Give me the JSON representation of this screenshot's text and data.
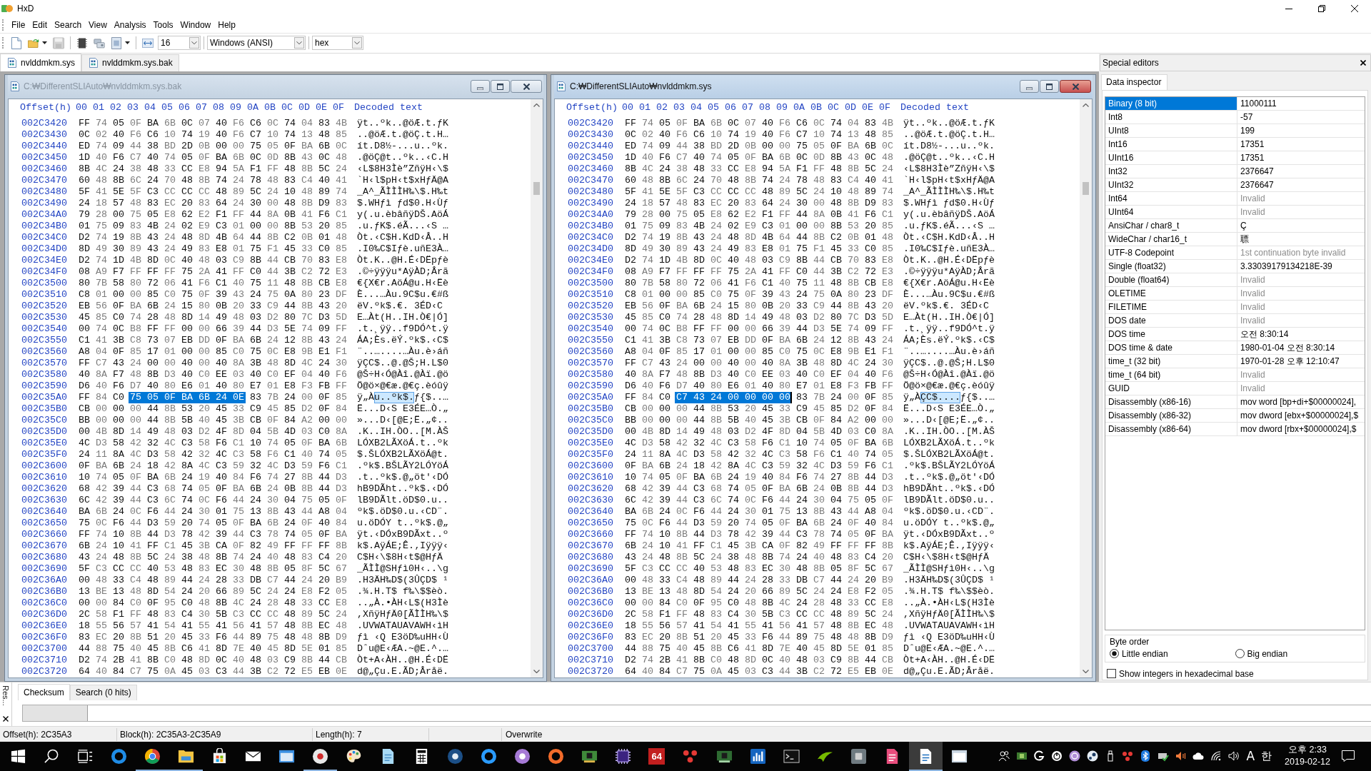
{
  "window": {
    "title": "HxD"
  },
  "menu": [
    "File",
    "Edit",
    "Search",
    "View",
    "Analysis",
    "Tools",
    "Window",
    "Help"
  ],
  "toolbar": {
    "bytes_per_row": "16",
    "encoding": "Windows (ANSI)",
    "offset_base": "hex"
  },
  "file_tabs": [
    {
      "label": "nvlddmkm.sys",
      "selected": true
    },
    {
      "label": "nvlddmkm.sys.bak",
      "selected": false
    }
  ],
  "editors": [
    {
      "title": "C:₩DifferentSLIAuto₩nvlddmkm.sys.bak",
      "active": false,
      "header": {
        "offset": "Offset(h)",
        "columns": [
          "00",
          "01",
          "02",
          "03",
          "04",
          "05",
          "06",
          "07",
          "08",
          "09",
          "0A",
          "0B",
          "0C",
          "0D",
          "0E",
          "0F"
        ],
        "decoded": "Decoded text"
      },
      "rows": [
        {
          "offset": "002C3420",
          "kind": "plain",
          "hex": "FF 74 05 0F BA 6B 0C 07 40 F6 C6 0C 74 04 83 4B",
          "decoded": "ÿt..ºk..@öÆ.t.ƒK"
        },
        {
          "offset": "002C3430",
          "kind": "plain",
          "hex": "0C 02 40 F6 C6 10 74 19 40 F6 C7 10 74 13 48 85",
          "decoded": "..@öÆ.t.@öÇ.t.H…"
        },
        {
          "offset": "002C3440",
          "kind": "plain",
          "hex": "ED 74 09 44 38 BD 2D 0B 00 00 75 05 0F BA 6B 0C",
          "decoded": "ít.D8½-...u..ºk."
        },
        {
          "offset": "002C3450",
          "kind": "plain",
          "hex": "1D 40 F6 C7 40 74 05 0F BA 6B 0C 0D 8B 43 0C 48",
          "decoded": ".@öÇ@t..ºk..‹C.H"
        },
        {
          "offset": "002C3460",
          "kind": "plain",
          "hex": "8B 4C 24 38 48 33 CC E8 94 5A F1 FF 48 8B 5C 24",
          "decoded": "‹L$8H3Ìè”ZñÿH‹\\$"
        },
        {
          "offset": "002C3470",
          "kind": "plain",
          "hex": "60 48 8B 6C 24 70 48 8B 74 24 78 48 83 C4 40 41",
          "decoded": "`H‹l$pH‹t$xHƒÄ@A"
        },
        {
          "offset": "002C3480",
          "kind": "plain",
          "hex": "5F 41 5E 5F C3 CC CC CC 48 89 5C 24 10 48 89 74",
          "decoded": "_A^_ÃÌÌÌH‰\\$.H‰t"
        },
        {
          "offset": "002C3490",
          "kind": "plain",
          "hex": "24 18 57 48 83 EC 20 83 64 24 30 00 48 8B D9 83",
          "decoded": "$.WHƒì ƒd$0.H‹Ùƒ"
        },
        {
          "offset": "002C34A0",
          "kind": "plain",
          "hex": "79 28 00 75 05 E8 62 E2 F1 FF 44 8A 0B 41 F6 C1",
          "decoded": "y(.u.èbâñÿDŠ.AöÁ"
        },
        {
          "offset": "002C34B0",
          "kind": "plain",
          "hex": "01 75 09 83 4B 24 02 E9 C3 01 00 00 8B 53 20 85",
          "decoded": ".u.ƒK$.éÃ...‹S …"
        },
        {
          "offset": "002C34C0",
          "kind": "plain",
          "hex": "D2 74 19 8B 43 24 48 8D 4B 64 44 8B C2 0B 01 48",
          "decoded": "Òt.‹C$H.KdD‹Â..H"
        },
        {
          "offset": "002C34D0",
          "kind": "plain",
          "hex": "8D 49 30 89 43 24 49 83 E8 01 75 F1 45 33 C0 85",
          "decoded": ".I0‰C$Iƒè.uñE3À…"
        },
        {
          "offset": "002C34E0",
          "kind": "plain",
          "hex": "D2 74 1D 4B 8D 0C 40 48 03 C9 8B 44 CB 70 83 E8",
          "decoded": "Òt.K..@H.É‹DËpƒè"
        },
        {
          "offset": "002C34F0",
          "kind": "plain",
          "hex": "08 A9 F7 FF FF FF 75 2A 41 FF C0 44 3B C2 72 E3",
          "decoded": ".©÷ÿÿÿu*AÿÀD;Ârã"
        },
        {
          "offset": "002C3500",
          "kind": "plain",
          "hex": "80 7B 58 80 72 06 41 F6 C1 40 75 11 48 8B CB E8",
          "decoded": "€{X€r.AöÁ@u.H‹Ëè"
        },
        {
          "offset": "002C3510",
          "kind": "plain",
          "hex": "C8 01 00 00 85 C0 75 0F 39 43 24 75 0A 80 23 DF",
          "decoded": "È...…Àu.9C$u.€#ß"
        },
        {
          "offset": "002C3520",
          "kind": "plain",
          "hex": "EB 56 0F BA 6B 24 15 80 0B 20 33 C9 44 8B 43 20",
          "decoded": "ëV.ºk$.€. 3ÉD‹C "
        },
        {
          "offset": "002C3530",
          "kind": "plain",
          "hex": "45 85 C0 74 28 48 8D 14 49 48 03 D2 80 7C D3 5D",
          "decoded": "E…Àt(H..IH.Ò€|Ó]"
        },
        {
          "offset": "002C3540",
          "kind": "plain",
          "hex": "00 74 0C B8 FF FF 00 00 66 39 44 D3 5E 74 09 FF",
          "decoded": ".t.¸ÿÿ..f9DÓ^t.ÿ"
        },
        {
          "offset": "002C3550",
          "kind": "plain",
          "hex": "C1 41 3B C8 73 07 EB DD 0F BA 6B 24 12 8B 43 24",
          "decoded": "ÁA;Ès.ëÝ.ºk$.‹C$"
        },
        {
          "offset": "002C3560",
          "kind": "plain",
          "hex": "A8 04 0F 85 17 01 00 00 85 C0 75 0C E8 9B E1 F1",
          "decoded": "¨..…....…Àu.è›áñ"
        },
        {
          "offset": "002C3570",
          "kind": "plain",
          "hex": "FF C7 43 24 00 00 40 00 40 8A 3B 48 8D 4C 24 30",
          "decoded": "ÿÇC$..@.@Š;H.L$0"
        },
        {
          "offset": "002C3580",
          "kind": "plain",
          "hex": "40 8A F7 48 8B D3 40 C0 EE 03 40 C0 EF 04 40 F6",
          "decoded": "@Š÷H‹Ó@Àî.@Àï.@ö"
        },
        {
          "offset": "002C3590",
          "kind": "plain",
          "hex": "D6 40 F6 D7 40 80 E6 01 40 80 E7 01 E8 F3 FB FF",
          "decoded": "Ö@ö×@€æ.@€ç.èóûÿ"
        },
        {
          "offset": "002C35A0",
          "kind": "selection",
          "hex": [
            {
              "text": "FF 84 C0",
              "selected": false
            },
            {
              "text": "75 05 0F BA 6B 24 0E",
              "selected": true
            },
            {
              "text": "83 7B 24 00 0F 85",
              "selected": false
            }
          ],
          "decoded": [
            {
              "text": "ÿ„À",
              "selected": false
            },
            {
              "text": "u..ºk$.",
              "selected": true
            },
            {
              "text": "ƒ{$..…",
              "selected": false
            }
          ]
        },
        {
          "offset": "002C35B0",
          "kind": "plain",
          "hex": "CB 00 00 00 44 8B 53 20 45 33 C9 45 85 D2 0F 84",
          "decoded": "Ë...D‹S E3ÉE…Ò.„"
        },
        {
          "offset": "002C35C0",
          "kind": "plain",
          "hex": "BB 00 00 00 44 8B 5B 40 45 3B CB 0F 84 A2 00 00",
          "decoded": "»...D‹[@E;Ë.„¢.."
        },
        {
          "offset": "002C35D0",
          "kind": "plain",
          "hex": "00 4B 8D 14 49 48 03 D2 4F 8D 04 5B 4D 03 C0 8A",
          "decoded": ".K..IH.ÒO..[M.ÀŠ"
        },
        {
          "offset": "002C35E0",
          "kind": "plain",
          "hex": "4C D3 58 42 32 4C C3 58 F6 C1 10 74 05 0F BA 6B",
          "decoded": "LÓXB2LÃXöÁ.t..ºk"
        },
        {
          "offset": "002C35F0",
          "kind": "plain",
          "hex": "24 11 8A 4C D3 58 42 32 4C C3 58 F6 C1 40 74 05",
          "decoded": "$.ŠLÓXB2LÃXöÁ@t."
        },
        {
          "offset": "002C3600",
          "kind": "plain",
          "hex": "0F BA 6B 24 18 42 8A 4C C3 59 32 4C D3 59 F6 C1",
          "decoded": ".ºk$.BŠLÃY2LÓYöÁ"
        },
        {
          "offset": "002C3610",
          "kind": "plain",
          "hex": "10 74 05 0F BA 6B 24 19 40 84 F6 74 27 8B 44 D3",
          "decoded": ".t..ºk$.@„öt'‹DÓ"
        },
        {
          "offset": "002C3620",
          "kind": "plain",
          "hex": "68 42 39 44 C3 68 74 05 0F BA 6B 24 0B 8B 44 D3",
          "decoded": "hB9DÃht..ºk$.‹DÓ"
        },
        {
          "offset": "002C3630",
          "kind": "plain",
          "hex": "6C 42 39 44 C3 6C 74 0C F6 44 24 30 04 75 05 0F",
          "decoded": "lB9DÃlt.öD$0.u.."
        },
        {
          "offset": "002C3640",
          "kind": "plain",
          "hex": "BA 6B 24 0C F6 44 24 30 01 75 13 8B 43 44 A8 04",
          "decoded": "ºk$.öD$0.u.‹CD¨."
        },
        {
          "offset": "002C3650",
          "kind": "plain",
          "hex": "75 0C F6 44 D3 59 20 74 05 0F BA 6B 24 0F 40 84",
          "decoded": "u.öDÓY t..ºk$.@„"
        },
        {
          "offset": "002C3660",
          "kind": "plain",
          "hex": "FF 74 10 8B 44 D3 78 42 39 44 C3 78 74 05 0F BA",
          "decoded": "ÿt.‹DÓxB9DÃxt..º"
        },
        {
          "offset": "002C3670",
          "kind": "plain",
          "hex": "6B 24 10 41 FF C1 45 3B CA 0F 82 49 FF FF FF 8B",
          "decoded": "k$.AÿÁE;Ê.‚Iÿÿÿ‹"
        },
        {
          "offset": "002C3680",
          "kind": "plain",
          "hex": "43 24 48 8B 5C 24 38 48 8B 74 24 40 48 83 C4 20",
          "decoded": "C$H‹\\$8H‹t$@HƒÄ "
        },
        {
          "offset": "002C3690",
          "kind": "plain",
          "hex": "5F C3 CC CC 40 53 48 83 EC 30 48 8B 05 8F 5C 67",
          "decoded": "_ÃÌÌ@SHƒì0H‹..\\g"
        },
        {
          "offset": "002C36A0",
          "kind": "plain",
          "hex": "00 48 33 C4 48 89 44 24 28 33 DB C7 44 24 20 B9",
          "decoded": ".H3ÄH‰D$(3ÛÇD$ ¹"
        },
        {
          "offset": "002C36B0",
          "kind": "plain",
          "hex": "13 BE 13 48 8D 54 24 20 66 89 5C 24 24 E8 F2 05",
          "decoded": ".¾.H.T$ f‰\\$$èò."
        },
        {
          "offset": "002C36C0",
          "kind": "plain",
          "hex": "00 00 84 C0 0F 95 C0 48 8B 4C 24 28 48 33 CC E8",
          "decoded": "..„À.•ÀH‹L$(H3Ìè"
        },
        {
          "offset": "002C36D0",
          "kind": "plain",
          "hex": "2C 58 F1 FF 48 83 C4 30 5B C3 CC CC 48 89 5C 24",
          "decoded": ",XñÿHƒÄ0[ÃÌÌH‰\\$"
        },
        {
          "offset": "002C36E0",
          "kind": "plain",
          "hex": "18 55 56 57 41 54 41 55 41 56 41 57 48 8B EC 48",
          "decoded": ".UVWATAUAVAWH‹ìH"
        },
        {
          "offset": "002C36F0",
          "kind": "plain",
          "hex": "83 EC 20 8B 51 20 45 33 F6 44 89 75 48 48 8B D9",
          "decoded": "ƒì ‹Q E3öD‰uHH‹Ù"
        },
        {
          "offset": "002C3700",
          "kind": "plain",
          "hex": "44 88 75 40 45 8B C6 41 8D 7E 40 45 8D 5E 01 85",
          "decoded": "Dˆu@E‹ÆA.~@E.^.…"
        },
        {
          "offset": "002C3710",
          "kind": "plain",
          "hex": "D2 74 2B 41 8B C0 48 8D 0C 40 48 03 C9 8B 44 CB",
          "decoded": "Òt+A‹ÀH..@H.É‹DË"
        },
        {
          "offset": "002C3720",
          "kind": "plain",
          "hex": "64 40 84 C7 75 0A 45 03 C3 44 3B C2 72 E5 EB 0E",
          "decoded": "d@„Çu.E.ÃD;Âråë."
        }
      ]
    },
    {
      "title": "C:₩DifferentSLIAuto₩nvlddmkm.sys",
      "active": true,
      "header": {
        "offset": "Offset(h)",
        "columns": [
          "00",
          "01",
          "02",
          "03",
          "04",
          "05",
          "06",
          "07",
          "08",
          "09",
          "0A",
          "0B",
          "0C",
          "0D",
          "0E",
          "0F"
        ],
        "decoded": "Decoded text"
      },
      "rows": [
        {
          "offset": "002C3420",
          "kind": "plain",
          "hex": "FF 74 05 0F BA 6B 0C 07 40 F6 C6 0C 74 04 83 4B",
          "decoded": "ÿt..ºk..@öÆ.t.ƒK"
        },
        {
          "offset": "002C3430",
          "kind": "plain",
          "hex": "0C 02 40 F6 C6 10 74 19 40 F6 C7 10 74 13 48 85",
          "decoded": "..@öÆ.t.@öÇ.t.H…"
        },
        {
          "offset": "002C3440",
          "kind": "plain",
          "hex": "ED 74 09 44 38 BD 2D 0B 00 00 75 05 0F BA 6B 0C",
          "decoded": "ít.D8½-...u..ºk."
        },
        {
          "offset": "002C3450",
          "kind": "plain",
          "hex": "1D 40 F6 C7 40 74 05 0F BA 6B 0C 0D 8B 43 0C 48",
          "decoded": ".@öÇ@t..ºk..‹C.H"
        },
        {
          "offset": "002C3460",
          "kind": "plain",
          "hex": "8B 4C 24 38 48 33 CC E8 94 5A F1 FF 48 8B 5C 24",
          "decoded": "‹L$8H3Ìè”ZñÿH‹\\$"
        },
        {
          "offset": "002C3470",
          "kind": "plain",
          "hex": "60 48 8B 6C 24 70 48 8B 74 24 78 48 83 C4 40 41",
          "decoded": "`H‹l$pH‹t$xHƒÄ@A"
        },
        {
          "offset": "002C3480",
          "kind": "plain",
          "hex": "5F 41 5E 5F C3 CC CC CC 48 89 5C 24 10 48 89 74",
          "decoded": "_A^_ÃÌÌÌH‰\\$.H‰t"
        },
        {
          "offset": "002C3490",
          "kind": "plain",
          "hex": "24 18 57 48 83 EC 20 83 64 24 30 00 48 8B D9 83",
          "decoded": "$.WHƒì ƒd$0.H‹Ùƒ"
        },
        {
          "offset": "002C34A0",
          "kind": "plain",
          "hex": "79 28 00 75 05 E8 62 E2 F1 FF 44 8A 0B 41 F6 C1",
          "decoded": "y(.u.èbâñÿDŠ.AöÁ"
        },
        {
          "offset": "002C34B0",
          "kind": "plain",
          "hex": "01 75 09 83 4B 24 02 E9 C3 01 00 00 8B 53 20 85",
          "decoded": ".u.ƒK$.éÃ...‹S …"
        },
        {
          "offset": "002C34C0",
          "kind": "plain",
          "hex": "D2 74 19 8B 43 24 48 8D 4B 64 44 8B C2 0B 01 48",
          "decoded": "Òt.‹C$H.KdD‹Â..H"
        },
        {
          "offset": "002C34D0",
          "kind": "plain",
          "hex": "8D 49 30 89 43 24 49 83 E8 01 75 F1 45 33 C0 85",
          "decoded": ".I0‰C$Iƒè.uñE3À…"
        },
        {
          "offset": "002C34E0",
          "kind": "plain",
          "hex": "D2 74 1D 4B 8D 0C 40 48 03 C9 8B 44 CB 70 83 E8",
          "decoded": "Òt.K..@H.É‹DËpƒè"
        },
        {
          "offset": "002C34F0",
          "kind": "plain",
          "hex": "08 A9 F7 FF FF FF 75 2A 41 FF C0 44 3B C2 72 E3",
          "decoded": ".©÷ÿÿÿu*AÿÀD;Ârã"
        },
        {
          "offset": "002C3500",
          "kind": "plain",
          "hex": "80 7B 58 80 72 06 41 F6 C1 40 75 11 48 8B CB E8",
          "decoded": "€{X€r.AöÁ@u.H‹Ëè"
        },
        {
          "offset": "002C3510",
          "kind": "plain",
          "hex": "C8 01 00 00 85 C0 75 0F 39 43 24 75 0A 80 23 DF",
          "decoded": "È...…Àu.9C$u.€#ß"
        },
        {
          "offset": "002C3520",
          "kind": "plain",
          "hex": "EB 56 0F BA 6B 24 15 80 0B 20 33 C9 44 8B 43 20",
          "decoded": "ëV.ºk$.€. 3ÉD‹C "
        },
        {
          "offset": "002C3530",
          "kind": "plain",
          "hex": "45 85 C0 74 28 48 8D 14 49 48 03 D2 80 7C D3 5D",
          "decoded": "E…Àt(H..IH.Ò€|Ó]"
        },
        {
          "offset": "002C3540",
          "kind": "plain",
          "hex": "00 74 0C B8 FF FF 00 00 66 39 44 D3 5E 74 09 FF",
          "decoded": ".t.¸ÿÿ..f9DÓ^t.ÿ"
        },
        {
          "offset": "002C3550",
          "kind": "plain",
          "hex": "C1 41 3B C8 73 07 EB DD 0F BA 6B 24 12 8B 43 24",
          "decoded": "ÁA;Ès.ëÝ.ºk$.‹C$"
        },
        {
          "offset": "002C3560",
          "kind": "plain",
          "hex": "A8 04 0F 85 17 01 00 00 85 C0 75 0C E8 9B E1 F1",
          "decoded": "¨..…....…Àu.è›áñ"
        },
        {
          "offset": "002C3570",
          "kind": "plain",
          "hex": "FF C7 43 24 00 00 40 00 40 8A 3B 48 8D 4C 24 30",
          "decoded": "ÿÇC$..@.@Š;H.L$0"
        },
        {
          "offset": "002C3580",
          "kind": "plain",
          "hex": "40 8A F7 48 8B D3 40 C0 EE 03 40 C0 EF 04 40 F6",
          "decoded": "@Š÷H‹Ó@Àî.@Àï.@ö"
        },
        {
          "offset": "002C3590",
          "kind": "plain",
          "hex": "D6 40 F6 D7 40 80 E6 01 40 80 E7 01 E8 F3 FB FF",
          "decoded": "Ö@ö×@€æ.@€ç.èóûÿ"
        },
        {
          "offset": "002C35A0",
          "kind": "selection",
          "hex": [
            {
              "text": "FF 84 C0",
              "selected": false
            },
            {
              "text": "C7 43 24 00 00 00 00",
              "selected": true
            },
            {
              "text": "83 7B 24 00 0F 85",
              "selected": false
            }
          ],
          "decoded": [
            {
              "text": "ÿ„À",
              "selected": false
            },
            {
              "text": "ÇC$....",
              "selected": true
            },
            {
              "text": "ƒ{$..…",
              "selected": false
            }
          ]
        },
        {
          "offset": "002C35B0",
          "kind": "plain",
          "hex": "CB 00 00 00 44 8B 53 20 45 33 C9 45 85 D2 0F 84",
          "decoded": "Ë...D‹S E3ÉE…Ò.„"
        },
        {
          "offset": "002C35C0",
          "kind": "plain",
          "hex": "BB 00 00 00 44 8B 5B 40 45 3B CB 0F 84 A2 00 00",
          "decoded": "»...D‹[@E;Ë.„¢.."
        },
        {
          "offset": "002C35D0",
          "kind": "plain",
          "hex": "00 4B 8D 14 49 48 03 D2 4F 8D 04 5B 4D 03 C0 8A",
          "decoded": ".K..IH.ÒO..[M.ÀŠ"
        },
        {
          "offset": "002C35E0",
          "kind": "plain",
          "hex": "4C D3 58 42 32 4C C3 58 F6 C1 10 74 05 0F BA 6B",
          "decoded": "LÓXB2LÃXöÁ.t..ºk"
        },
        {
          "offset": "002C35F0",
          "kind": "plain",
          "hex": "24 11 8A 4C D3 58 42 32 4C C3 58 F6 C1 40 74 05",
          "decoded": "$.ŠLÓXB2LÃXöÁ@t."
        },
        {
          "offset": "002C3600",
          "kind": "plain",
          "hex": "0F BA 6B 24 18 42 8A 4C C3 59 32 4C D3 59 F6 C1",
          "decoded": ".ºk$.BŠLÃY2LÓYöÁ"
        },
        {
          "offset": "002C3610",
          "kind": "plain",
          "hex": "10 74 05 0F BA 6B 24 19 40 84 F6 74 27 8B 44 D3",
          "decoded": ".t..ºk$.@„öt'‹DÓ"
        },
        {
          "offset": "002C3620",
          "kind": "plain",
          "hex": "68 42 39 44 C3 68 74 05 0F BA 6B 24 0B 8B 44 D3",
          "decoded": "hB9DÃht..ºk$.‹DÓ"
        },
        {
          "offset": "002C3630",
          "kind": "plain",
          "hex": "6C 42 39 44 C3 6C 74 0C F6 44 24 30 04 75 05 0F",
          "decoded": "lB9DÃlt.öD$0.u.."
        },
        {
          "offset": "002C3640",
          "kind": "plain",
          "hex": "BA 6B 24 0C F6 44 24 30 01 75 13 8B 43 44 A8 04",
          "decoded": "ºk$.öD$0.u.‹CD¨."
        },
        {
          "offset": "002C3650",
          "kind": "plain",
          "hex": "75 0C F6 44 D3 59 20 74 05 0F BA 6B 24 0F 40 84",
          "decoded": "u.öDÓY t..ºk$.@„"
        },
        {
          "offset": "002C3660",
          "kind": "plain",
          "hex": "FF 74 10 8B 44 D3 78 42 39 44 C3 78 74 05 0F BA",
          "decoded": "ÿt.‹DÓxB9DÃxt..º"
        },
        {
          "offset": "002C3670",
          "kind": "plain",
          "hex": "6B 24 10 41 FF C1 45 3B CA 0F 82 49 FF FF FF 8B",
          "decoded": "k$.AÿÁE;Ê.‚Iÿÿÿ‹"
        },
        {
          "offset": "002C3680",
          "kind": "plain",
          "hex": "43 24 48 8B 5C 24 38 48 8B 74 24 40 48 83 C4 20",
          "decoded": "C$H‹\\$8H‹t$@HƒÄ "
        },
        {
          "offset": "002C3690",
          "kind": "plain",
          "hex": "5F C3 CC CC 40 53 48 83 EC 30 48 8B 05 8F 5C 67",
          "decoded": "_ÃÌÌ@SHƒì0H‹..\\g"
        },
        {
          "offset": "002C36A0",
          "kind": "plain",
          "hex": "00 48 33 C4 48 89 44 24 28 33 DB C7 44 24 20 B9",
          "decoded": ".H3ÄH‰D$(3ÛÇD$ ¹"
        },
        {
          "offset": "002C36B0",
          "kind": "plain",
          "hex": "13 BE 13 48 8D 54 24 20 66 89 5C 24 24 E8 F2 05",
          "decoded": ".¾.H.T$ f‰\\$$èò."
        },
        {
          "offset": "002C36C0",
          "kind": "plain",
          "hex": "00 00 84 C0 0F 95 C0 48 8B 4C 24 28 48 33 CC E8",
          "decoded": "..„À.•ÀH‹L$(H3Ìè"
        },
        {
          "offset": "002C36D0",
          "kind": "plain",
          "hex": "2C 58 F1 FF 48 83 C4 30 5B C3 CC CC 48 89 5C 24",
          "decoded": ",XñÿHƒÄ0[ÃÌÌH‰\\$"
        },
        {
          "offset": "002C36E0",
          "kind": "plain",
          "hex": "18 55 56 57 41 54 41 55 41 56 41 57 48 8B EC 48",
          "decoded": ".UVWATAUAVAWH‹ìH"
        },
        {
          "offset": "002C36F0",
          "kind": "plain",
          "hex": "83 EC 20 8B 51 20 45 33 F6 44 89 75 48 48 8B D9",
          "decoded": "ƒì ‹Q E3öD‰uHH‹Ù"
        },
        {
          "offset": "002C3700",
          "kind": "plain",
          "hex": "44 88 75 40 45 8B C6 41 8D 7E 40 45 8D 5E 01 85",
          "decoded": "Dˆu@E‹ÆA.~@E.^.…"
        },
        {
          "offset": "002C3710",
          "kind": "plain",
          "hex": "D2 74 2B 41 8B C0 48 8D 0C 40 48 03 C9 8B 44 CB",
          "decoded": "Òt+A‹ÀH..@H.É‹DË"
        },
        {
          "offset": "002C3720",
          "kind": "plain",
          "hex": "64 40 84 C7 75 0A 45 03 C3 44 3B C2 72 E5 EB 0E",
          "decoded": "d@„Çu.E.ÃD;Âråë."
        }
      ]
    }
  ],
  "special_editors": {
    "title": "Special editors",
    "tabs": [
      {
        "label": "Data inspector",
        "selected": true
      }
    ],
    "rows": [
      {
        "name": "Binary (8 bit)",
        "value": "11000111",
        "selected": true,
        "invalid": false
      },
      {
        "name": "Int8",
        "value": "-57",
        "selected": false,
        "invalid": false
      },
      {
        "name": "UInt8",
        "value": "199",
        "selected": false,
        "invalid": false
      },
      {
        "name": "Int16",
        "value": "17351",
        "selected": false,
        "invalid": false
      },
      {
        "name": "UInt16",
        "value": "17351",
        "selected": false,
        "invalid": false
      },
      {
        "name": "Int32",
        "value": "2376647",
        "selected": false,
        "invalid": false
      },
      {
        "name": "UInt32",
        "value": "2376647",
        "selected": false,
        "invalid": false
      },
      {
        "name": "Int64",
        "value": "Invalid",
        "selected": false,
        "invalid": true
      },
      {
        "name": "UInt64",
        "value": "Invalid",
        "selected": false,
        "invalid": true
      },
      {
        "name": "AnsiChar / char8_t",
        "value": "Ç",
        "selected": false,
        "invalid": false
      },
      {
        "name": "WideChar / char16_t",
        "value": "䏇",
        "selected": false,
        "invalid": false
      },
      {
        "name": "UTF-8 Codepoint",
        "value": "1st continuation byte invalid",
        "selected": false,
        "invalid": true
      },
      {
        "name": "Single (float32)",
        "value": "3.33039179134218E-39",
        "selected": false,
        "invalid": false
      },
      {
        "name": "Double (float64)",
        "value": "Invalid",
        "selected": false,
        "invalid": true
      },
      {
        "name": "OLETIME",
        "value": "Invalid",
        "selected": false,
        "invalid": true
      },
      {
        "name": "FILETIME",
        "value": "Invalid",
        "selected": false,
        "invalid": true
      },
      {
        "name": "DOS date",
        "value": "Invalid",
        "selected": false,
        "invalid": true
      },
      {
        "name": "DOS time",
        "value": "오전 8:30:14",
        "selected": false,
        "invalid": false
      },
      {
        "name": "DOS time & date",
        "value": "1980-01-04 오전 8:30:14",
        "selected": false,
        "invalid": false
      },
      {
        "name": "time_t (32 bit)",
        "value": "1970-01-28 오후 12:10:47",
        "selected": false,
        "invalid": false
      },
      {
        "name": "time_t (64 bit)",
        "value": "Invalid",
        "selected": false,
        "invalid": true
      },
      {
        "name": "GUID",
        "value": "Invalid",
        "selected": false,
        "invalid": true
      },
      {
        "name": "Disassembly (x86-16)",
        "value": "mov word [bp+di+$00000024],",
        "selected": false,
        "invalid": false
      },
      {
        "name": "Disassembly (x86-32)",
        "value": "mov dword [ebx+$00000024],$",
        "selected": false,
        "invalid": false
      },
      {
        "name": "Disassembly (x86-64)",
        "value": "mov dword [rbx+$00000024],$",
        "selected": false,
        "invalid": false
      }
    ],
    "byte_order": {
      "label": "Byte order",
      "options": [
        {
          "label": "Little endian",
          "selected": true
        },
        {
          "label": "Big endian",
          "selected": false
        }
      ]
    },
    "hex_integers": {
      "label": "Show integers in hexadecimal base",
      "checked": false
    }
  },
  "results_panel": {
    "caption": "Res...",
    "tabs": [
      {
        "label": "Checksum",
        "selected": true
      },
      {
        "label": "Search (0 hits)",
        "selected": false
      }
    ]
  },
  "status_bar": [
    "Offset(h): 2C35A3",
    "Block(h): 2C35A3-2C35A9",
    "Length(h): 7",
    "Overwrite"
  ],
  "taskbar": {
    "apps": [
      {
        "kind": "start",
        "running": false,
        "selected": false
      },
      {
        "kind": "search",
        "running": false,
        "selected": false
      },
      {
        "kind": "task-view",
        "running": false,
        "selected": false
      },
      {
        "kind": "ring-blue",
        "running": false,
        "selected": false
      },
      {
        "kind": "pie",
        "running": true,
        "selected": false
      },
      {
        "kind": "folder",
        "running": true,
        "selected": false
      },
      {
        "kind": "bag",
        "running": false,
        "selected": false
      },
      {
        "kind": "envelope",
        "running": false,
        "selected": false
      },
      {
        "kind": "card-blue",
        "running": false,
        "selected": false
      },
      {
        "kind": "disc-red",
        "running": true,
        "selected": false
      },
      {
        "kind": "palette",
        "running": false,
        "selected": false
      },
      {
        "kind": "page",
        "running": false,
        "selected": false
      },
      {
        "kind": "calculator",
        "running": false,
        "selected": false
      },
      {
        "kind": "round-navy",
        "running": false,
        "selected": false
      },
      {
        "kind": "ring-sky",
        "running": false,
        "selected": false
      },
      {
        "kind": "round-violet",
        "running": false,
        "selected": false
      },
      {
        "kind": "ring-orange",
        "running": false,
        "selected": false
      },
      {
        "kind": "card",
        "running": false,
        "selected": false
      },
      {
        "kind": "square-violet",
        "running": false,
        "selected": false
      },
      {
        "kind": "tile",
        "label": "64",
        "running": false,
        "selected": false
      },
      {
        "kind": "dots",
        "running": false,
        "selected": false
      },
      {
        "kind": "chip",
        "running": false,
        "selected": false
      },
      {
        "kind": "chart",
        "running": false,
        "selected": false
      },
      {
        "kind": "terminal",
        "running": false,
        "selected": false
      },
      {
        "kind": "swoosh",
        "running": false,
        "selected": false
      },
      {
        "kind": "device",
        "running": false,
        "selected": false
      },
      {
        "kind": "page-pink",
        "running": false,
        "selected": false
      },
      {
        "kind": "hex",
        "running": true,
        "selected": true
      },
      {
        "kind": "monitor",
        "running": false,
        "selected": false
      }
    ],
    "input_mode": "A",
    "language": "한",
    "time": "오후 2:33",
    "date": "2019-02-12"
  }
}
